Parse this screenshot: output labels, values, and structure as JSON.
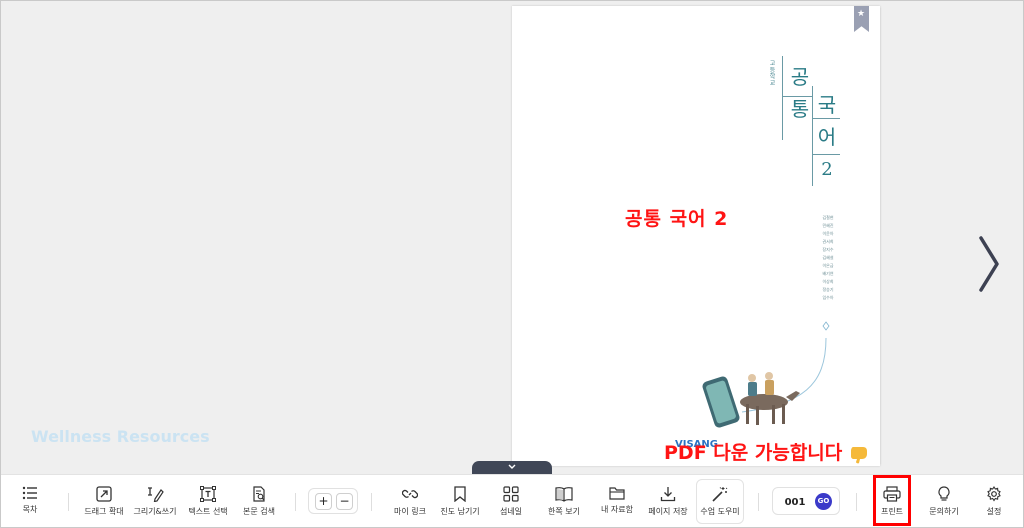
{
  "book": {
    "series_label": "고등학교",
    "title_col1": [
      "공",
      "통"
    ],
    "title_col2": [
      "국",
      "어",
      "2"
    ],
    "authors": [
      "김철현",
      "민혜진",
      "이윤아",
      "권서희",
      "장지수",
      "김혜설",
      "이은금",
      "배기연",
      "이상희",
      "정승기",
      "임수아"
    ],
    "publisher": "VISANG"
  },
  "annotations": {
    "title": "공통 국어 2",
    "pdf_note": "PDF 다운 가능합니다"
  },
  "watermark": "Wellness Resources",
  "toolbar": {
    "toc": "목차",
    "drag_zoom": "드래그 확대",
    "draw_write": "그리기&쓰기",
    "text_select": "텍스트 선택",
    "body_search": "본문 검색",
    "zoom_in": "+",
    "zoom_out": "−",
    "my_link": "마이 링크",
    "progress_bookmark": "진도 남기기",
    "thumbnail": "섬네일",
    "single_page": "한쪽 보기",
    "my_materials": "내 자료함",
    "save_page": "페이지 저장",
    "class_helper": "수업 도우미",
    "page_number": "001",
    "go": "GO",
    "print": "프린트",
    "inquiry": "문의하기",
    "settings": "설정"
  },
  "colors": {
    "highlight": "#ff0000",
    "annotation": "#ff1414",
    "go_button": "#3b3ac9",
    "title_teal": "#2a7b86"
  }
}
